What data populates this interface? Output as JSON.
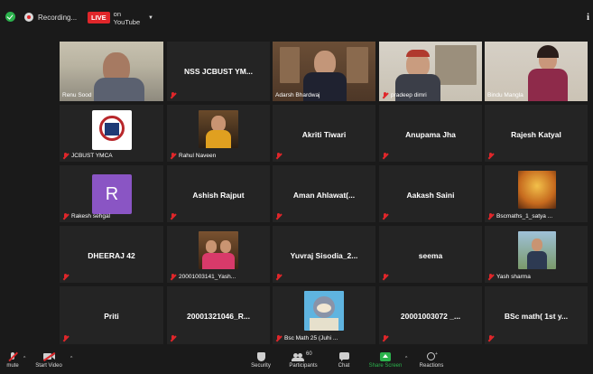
{
  "topbar": {
    "recording_label": "Recording...",
    "live_badge": "LIVE",
    "live_label": "on YouTube",
    "right_icon": "i"
  },
  "tiles": [
    {
      "name": "Renu Sood",
      "video": true
    },
    {
      "center": "NSS JCBUST YM...",
      "muted": true
    },
    {
      "name": "Adarsh Bhardwaj",
      "video": true
    },
    {
      "name": "pradeep dimri",
      "video": true,
      "muted": true
    },
    {
      "name": "Bindu Mangla",
      "video": true
    },
    {
      "name": "JCBUST YMCA",
      "muted": true
    },
    {
      "name": "Rahul Naveen",
      "muted": true
    },
    {
      "center": "Akriti Tiwari",
      "muted": true
    },
    {
      "center": "Anupama Jha",
      "muted": true
    },
    {
      "center": "Rajesh Katyal",
      "muted": true
    },
    {
      "name": "Rakesh sehgal",
      "muted": true,
      "avatar_letter": "R"
    },
    {
      "center": "Ashish Rajput",
      "muted": true
    },
    {
      "center": "Aman  Ahlawat(...",
      "muted": true
    },
    {
      "center": "Aakash Saini",
      "muted": true
    },
    {
      "name": "Bscmaths_1_satya ...",
      "muted": true
    },
    {
      "center": "DHEERAJ  42",
      "muted": true
    },
    {
      "name": "20001003141_Yash...",
      "muted": true
    },
    {
      "center": "Yuvraj  Sisodia_2...",
      "muted": true
    },
    {
      "center": "seema",
      "muted": true
    },
    {
      "name": "Yash sharma",
      "muted": true
    },
    {
      "center": "Priti",
      "muted": true
    },
    {
      "center": "20001321046_R...",
      "muted": true
    },
    {
      "name": "Bsc Math 25 (Juhi ...",
      "muted": true
    },
    {
      "center": "20001003072 _...",
      "muted": true
    },
    {
      "center": "BSc math( 1st y...",
      "muted": true
    }
  ],
  "toolbar": {
    "mute_label": "mute",
    "start_video_label": "Start Video",
    "security_label": "Security",
    "participants_label": "Participants",
    "participants_count": "60",
    "chat_label": "Chat",
    "share_screen_label": "Share Screen",
    "reactions_label": "Reactions"
  },
  "colors": {
    "active_speaker_border": "#c9d23b",
    "live_red": "#e0262a",
    "share_green": "#2bb24c"
  }
}
